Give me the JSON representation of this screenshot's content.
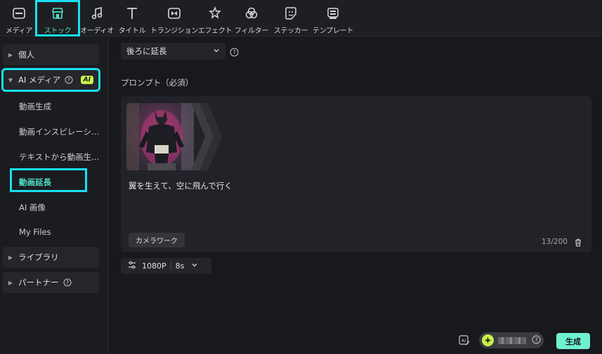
{
  "toolbar": {
    "tabs": [
      {
        "label": "メディア",
        "icon": "media-icon"
      },
      {
        "label": "ストック",
        "icon": "stock-icon",
        "active": true
      },
      {
        "label": "オーディオ",
        "icon": "audio-icon"
      },
      {
        "label": "タイトル",
        "icon": "title-icon"
      },
      {
        "label": "トランジション",
        "icon": "transition-icon"
      },
      {
        "label": "エフェクト",
        "icon": "effect-icon"
      },
      {
        "label": "フィルター",
        "icon": "filter-icon"
      },
      {
        "label": "ステッカー",
        "icon": "sticker-icon"
      },
      {
        "label": "テンプレート",
        "icon": "template-icon"
      }
    ]
  },
  "sidebar": {
    "personal": "個人",
    "ai_media": "AI メディア",
    "ai_badge": "AI",
    "ai_items": [
      "動画生成",
      "動画インスピレーシ...",
      "テキストから動画生...",
      "動画延長",
      "AI 画像",
      "My Files"
    ],
    "library": "ライブラリ",
    "partner": "パートナー"
  },
  "main": {
    "mode_select": "後ろに延長",
    "prompt_label": "プロンプト（必須）",
    "prompt_text": "翼を生えて、空に飛んで行く",
    "camera_work": "カメラワーク",
    "counter": "13/200",
    "resolution": "1080P",
    "duration": "8s",
    "generate": "生成"
  },
  "colors": {
    "accent": "#4fe0c8",
    "highlight_box": "#17e0f0",
    "ai_badge": "#c7f04a",
    "generate_button": "#6ff0cf"
  }
}
